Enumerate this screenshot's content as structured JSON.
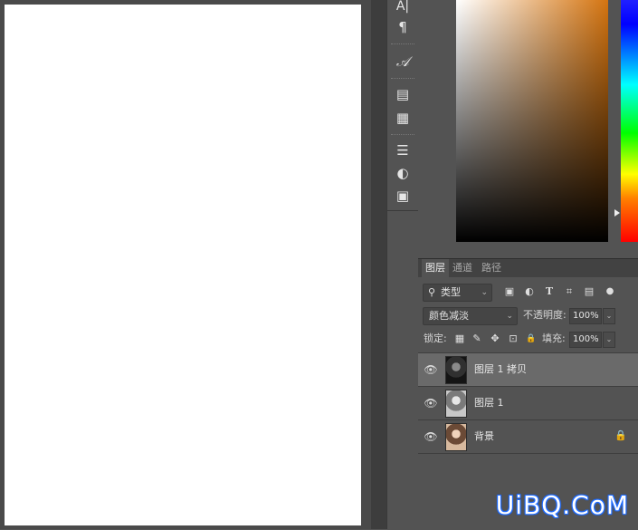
{
  "toolstrip": {
    "tools": [
      {
        "name": "character-icon",
        "glyph": "A|"
      },
      {
        "name": "paragraph-icon",
        "glyph": "¶"
      },
      {
        "name": "glyphs-icon",
        "glyph": "𝒜"
      },
      {
        "name": "character-styles-icon",
        "glyph": "▤"
      },
      {
        "name": "paragraph-styles-icon",
        "glyph": "▦"
      },
      {
        "name": "adjustments-icon",
        "glyph": "☰"
      },
      {
        "name": "styles-icon",
        "glyph": "◐"
      },
      {
        "name": "swatches-icon",
        "glyph": "▣"
      }
    ]
  },
  "layers_panel": {
    "tabs": [
      "图层",
      "通道",
      "路径"
    ],
    "filter": {
      "label": "类型",
      "search_icon": "⚲"
    },
    "filter_icons": [
      "▣",
      "◐",
      "T",
      "⌗",
      "▤",
      "●"
    ],
    "blend_mode": "颜色减淡",
    "opacity_label": "不透明度:",
    "opacity_value": "100%",
    "lock_label": "锁定:",
    "lock_icons": [
      "▦",
      "✎",
      "✥",
      "⊡",
      "🔒"
    ],
    "fill_label": "填充:",
    "fill_value": "100%",
    "layers": [
      {
        "name": "图层 1 拷贝",
        "selected": true,
        "thumb": "#262626"
      },
      {
        "name": "图层 1",
        "selected": false,
        "thumb": "#b9b9b9"
      },
      {
        "name": "背景",
        "selected": false,
        "thumb": "#c9a689",
        "locked": true
      }
    ]
  },
  "watermark": "UiBQ.CoM"
}
